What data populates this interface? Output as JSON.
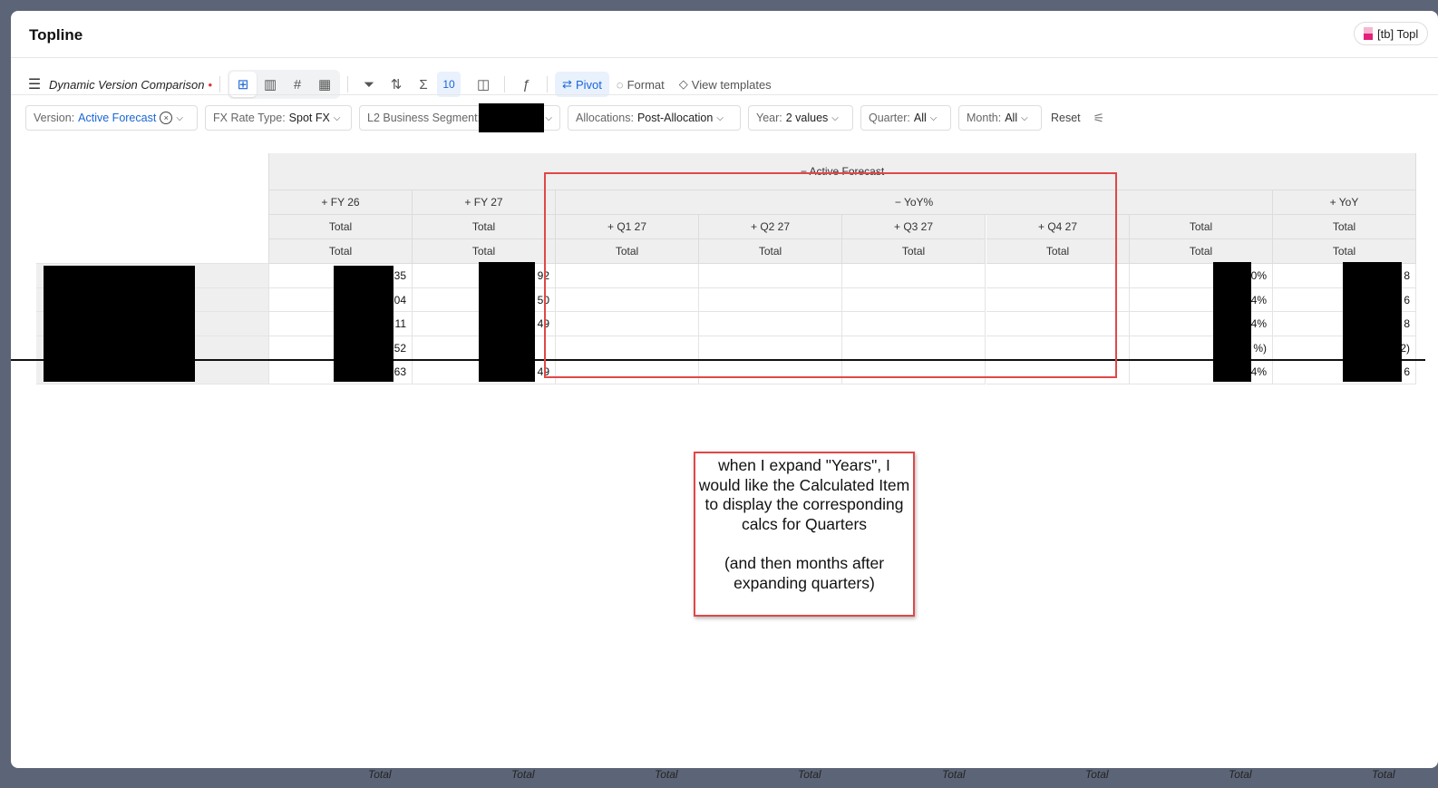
{
  "header": {
    "title": "Topline",
    "badge": "[tb] Topl"
  },
  "toolbar": {
    "menu_label": "Dynamic Version Comparison",
    "unsaved_dot": "•",
    "sum_count": "10",
    "pivot": "Pivot",
    "format": "Format",
    "view_templates": "View templates"
  },
  "filters": [
    {
      "label": "Version:",
      "value": "Active Forecast"
    },
    {
      "label": "FX Rate Type:",
      "value": "Spot FX"
    },
    {
      "label": "L2 Business Segment:",
      "value": ""
    },
    {
      "label": "Allocations:",
      "value": "Post-Allocation"
    },
    {
      "label": "Year:",
      "value": "2 values"
    },
    {
      "label": "Quarter:",
      "value": "All"
    },
    {
      "label": "Month:",
      "value": "All"
    }
  ],
  "reset": "Reset",
  "pivot": {
    "top_header": "− Active Forecast",
    "col_headers": [
      "+ FY 26",
      "+ FY 27",
      "− YoY%",
      "+ YoY"
    ],
    "quarters": [
      "+ Q1 27",
      "+ Q2 27",
      "+ Q3 27",
      "+ Q4 27"
    ],
    "total": "Total",
    "rows": [
      [
        "35",
        "92",
        "",
        "",
        "",
        "",
        "0%",
        "8"
      ],
      [
        "04",
        "50",
        "",
        "",
        "",
        "",
        "4%",
        "6"
      ],
      [
        "11",
        "49",
        "",
        "",
        "",
        "",
        "4%",
        "8"
      ],
      [
        "52",
        "",
        "",
        "",
        "",
        "",
        "%)",
        "2)"
      ],
      [
        "63",
        "49",
        "",
        "",
        "",
        "",
        "4%",
        "6"
      ]
    ]
  },
  "annotation": {
    "line1": "when I expand \"Years\", I would like the Calculated Item to display the corresponding calcs for Quarters",
    "line2": "(and then months after expanding quarters)"
  },
  "background_totals": [
    "Total",
    "Total",
    "Total",
    "Total",
    "Total",
    "Total",
    "Total",
    "Total"
  ]
}
